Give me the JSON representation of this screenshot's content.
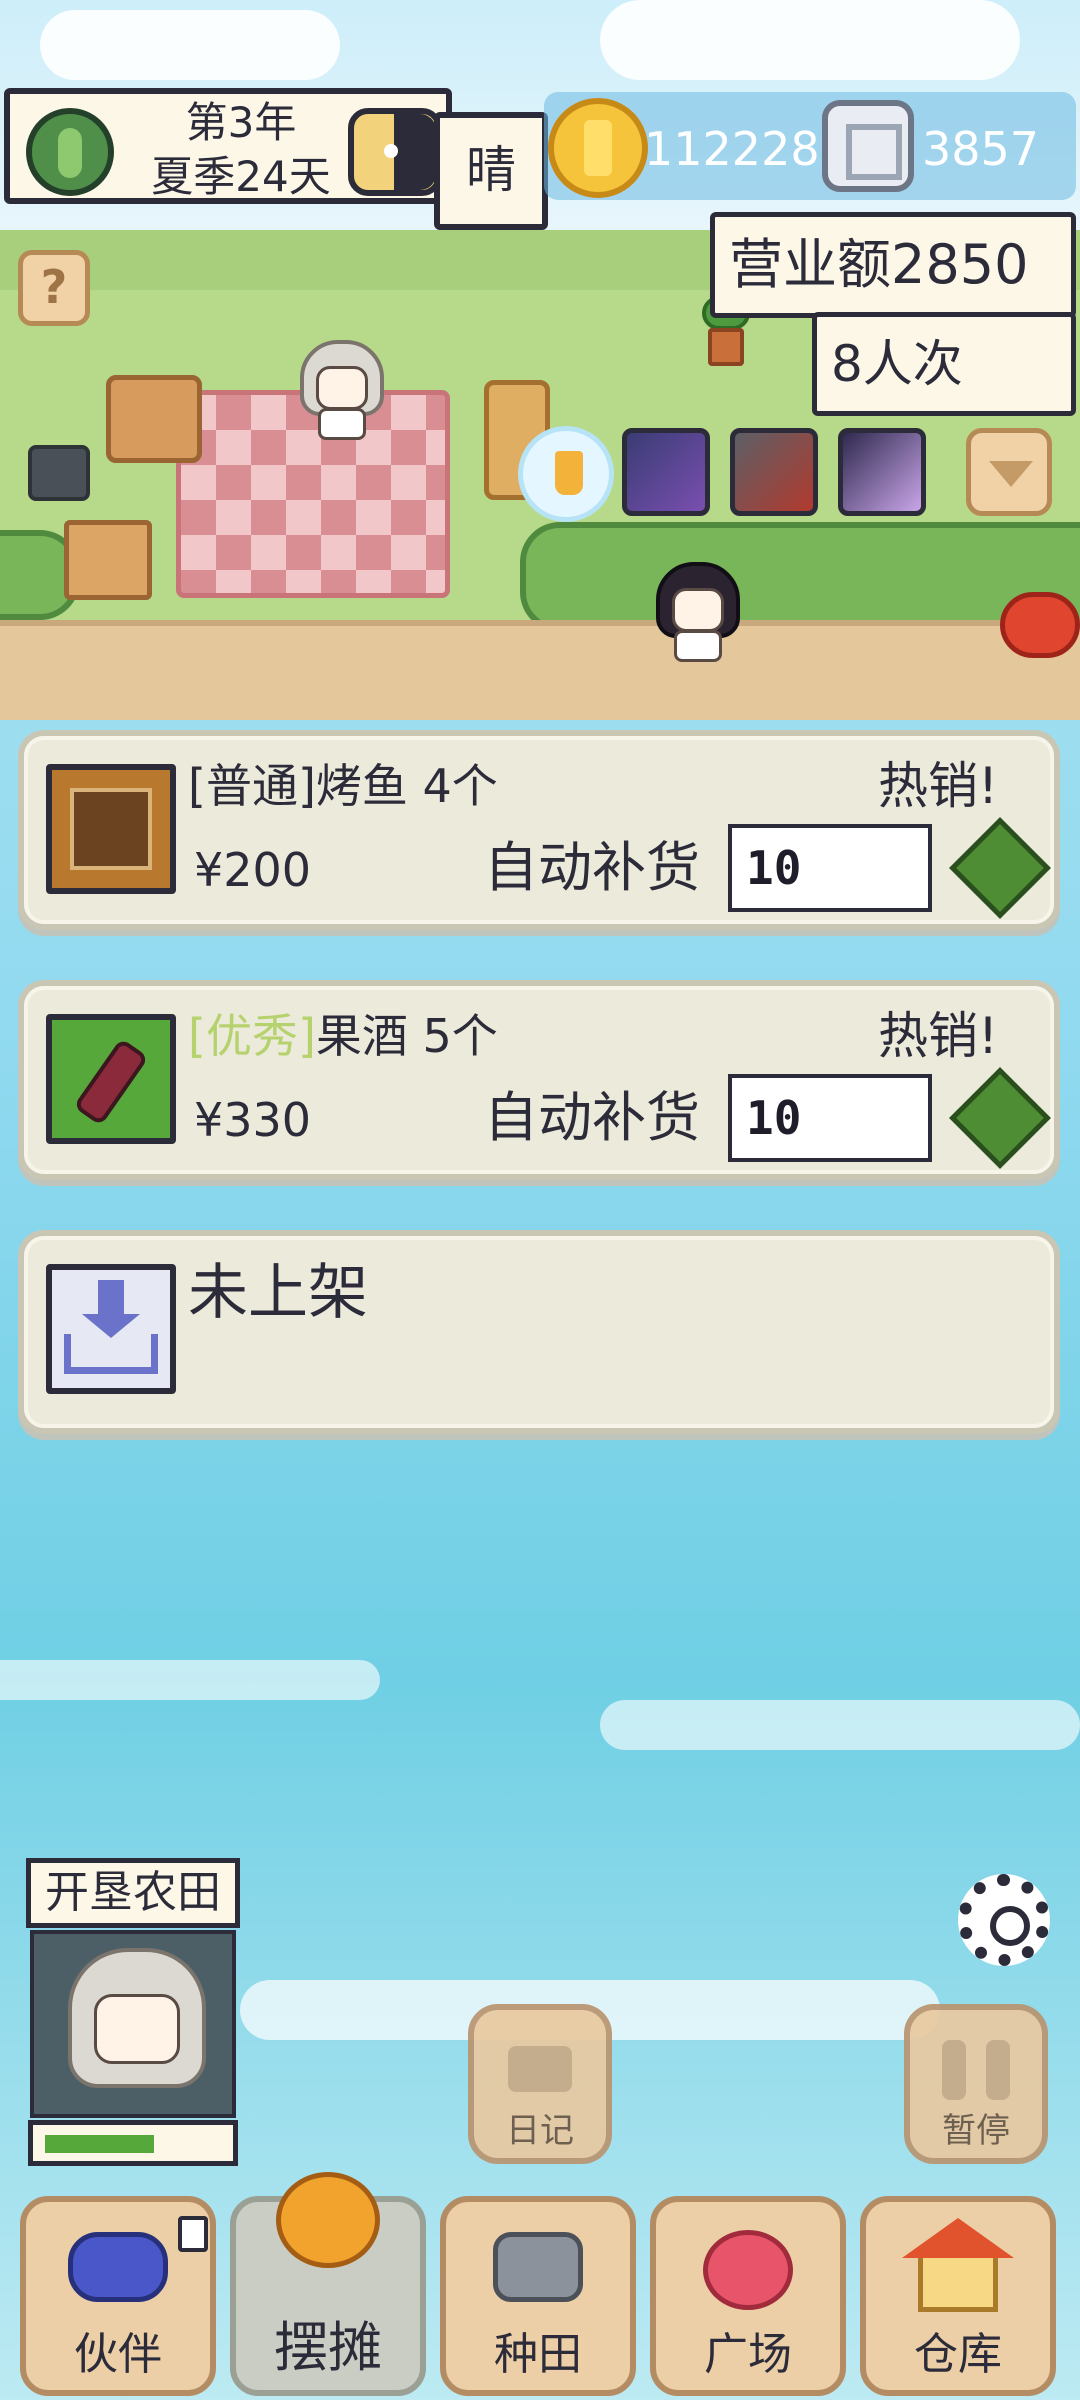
{
  "hud": {
    "date_line1": "第3年",
    "date_line2": "夏季24天",
    "weather": "晴",
    "coins": "112228",
    "gems": "3857",
    "revenue": "营业额2850",
    "customers": "8人次",
    "help": "?"
  },
  "goods": [
    {
      "quality": "[普通]",
      "name": "烤鱼 4个",
      "hot": "热销!",
      "price": "¥200",
      "auto_label": "自动补货",
      "auto_qty": "10"
    },
    {
      "quality": "[优秀]",
      "name": "果酒 5个",
      "hot": "热销!",
      "price": "¥330",
      "auto_label": "自动补货",
      "auto_qty": "10"
    }
  ],
  "empty_slot": {
    "label": "未上架"
  },
  "quest": {
    "title": "开垦农田",
    "progress": 0.62
  },
  "buttons": {
    "diary": "日记",
    "pause": "暂停"
  },
  "nav": [
    {
      "label": "伙伴",
      "icon": "partner-icon"
    },
    {
      "label": "摆摊",
      "icon": "stall-icon"
    },
    {
      "label": "种田",
      "icon": "farming-icon"
    },
    {
      "label": "广场",
      "icon": "plaza-icon"
    },
    {
      "label": "仓库",
      "icon": "warehouse-icon"
    }
  ],
  "colors": {
    "accent_good": "#b6d26e",
    "diamond": "#4e8d33",
    "progress": "#57a83b"
  }
}
